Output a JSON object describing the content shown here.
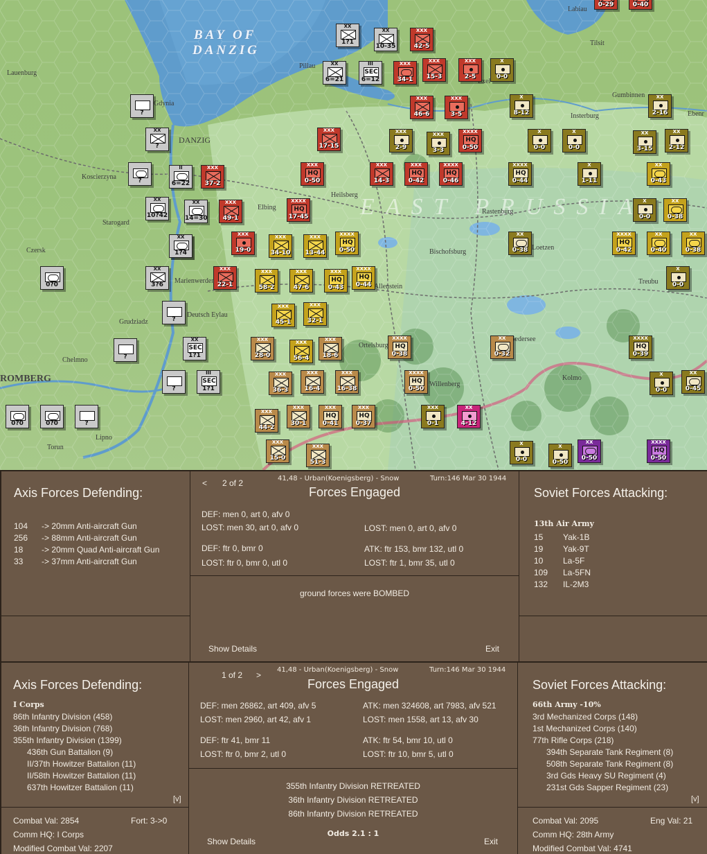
{
  "map": {
    "bay_label_1": "BAY OF",
    "bay_label_2": "DANZIG",
    "region_label": "EAST PRUSSIA",
    "places": [
      {
        "name": "Lauenburg"
      },
      {
        "name": "Gdynia"
      },
      {
        "name": "DANZIG"
      },
      {
        "name": "Koscierzyna"
      },
      {
        "name": "Starogard"
      },
      {
        "name": "Czersk"
      },
      {
        "name": "Elbing"
      },
      {
        "name": "Heilsberg"
      },
      {
        "name": "Marienwerder"
      },
      {
        "name": "Grudziadz"
      },
      {
        "name": "Deutsch Eylau"
      },
      {
        "name": "Chelmno"
      },
      {
        "name": "ROMBERG"
      },
      {
        "name": "Torun"
      },
      {
        "name": "Lipno"
      },
      {
        "name": "Allenstein"
      },
      {
        "name": "Ortelsburg"
      },
      {
        "name": "Willenberg"
      },
      {
        "name": "Bischofsburg"
      },
      {
        "name": "Rastenburg"
      },
      {
        "name": "Loetzen"
      },
      {
        "name": "Insterburg"
      },
      {
        "name": "Gumbinnen"
      },
      {
        "name": "Tilsit"
      },
      {
        "name": "Ebenr"
      },
      {
        "name": "Treubu"
      },
      {
        "name": "Kolmo"
      },
      {
        "name": "Pillau"
      },
      {
        "name": "Jab"
      },
      {
        "name": "Sedersee"
      },
      {
        "name": "Exel"
      },
      {
        "name": "Labiau"
      }
    ],
    "units": [
      {
        "id": "u1",
        "val": "1?1",
        "size": "XX",
        "color": "axis",
        "sym": "x"
      },
      {
        "id": "u2",
        "val": "10-35",
        "size": "XX",
        "color": "axis",
        "sym": "x"
      },
      {
        "id": "u3",
        "val": "42-5",
        "size": "XXX",
        "color": "red",
        "sym": "x"
      },
      {
        "id": "u4",
        "val": "6=21",
        "size": "XX",
        "color": "axis",
        "sym": "x"
      },
      {
        "id": "u5",
        "val": "6=12",
        "size": "III",
        "color": "axis",
        "sym": "hq",
        "label": "SEC"
      },
      {
        "id": "u6",
        "val": "34-1",
        "size": "XXX",
        "color": "red",
        "sym": "oval"
      },
      {
        "id": "u7",
        "val": "15-3",
        "size": "XXX",
        "color": "red",
        "sym": "x"
      },
      {
        "id": "u8",
        "val": "2-5",
        "size": "XXX",
        "color": "red",
        "sym": "dot"
      },
      {
        "id": "u9",
        "val": "0-0",
        "size": "X",
        "color": "olive",
        "sym": "dot"
      },
      {
        "id": "u10",
        "val": "?",
        "size": "",
        "color": "axis",
        "sym": "plain"
      },
      {
        "id": "u11",
        "val": "46-6",
        "size": "XXX",
        "color": "red",
        "sym": "x"
      },
      {
        "id": "u12",
        "val": "3-5",
        "size": "XXX",
        "color": "red",
        "sym": "dot"
      },
      {
        "id": "u13",
        "val": "8-12",
        "size": "X",
        "color": "olive",
        "sym": "dot"
      },
      {
        "id": "u14",
        "val": "2-16",
        "size": "XX",
        "color": "olive",
        "sym": "dot"
      },
      {
        "id": "u15",
        "val": "?",
        "size": "XX",
        "color": "axis",
        "sym": "x"
      },
      {
        "id": "u16",
        "val": "17-15",
        "size": "XXX",
        "color": "red",
        "sym": "x"
      },
      {
        "id": "u17",
        "val": "2-9",
        "size": "XXX",
        "color": "olive",
        "sym": "dot"
      },
      {
        "id": "u18",
        "val": "3-3",
        "size": "XXX",
        "color": "olive",
        "sym": "dot"
      },
      {
        "id": "u19",
        "val": "0-50",
        "size": "XXXX",
        "color": "red",
        "sym": "hq",
        "label": "HQ"
      },
      {
        "id": "u20",
        "val": "0-0",
        "size": "X",
        "color": "olive",
        "sym": "dot"
      },
      {
        "id": "u21",
        "val": "0-0",
        "size": "X",
        "color": "olive",
        "sym": "dot"
      },
      {
        "id": "u22",
        "val": "3-15",
        "size": "XX",
        "color": "olive",
        "sym": "dot"
      },
      {
        "id": "u23",
        "val": "2-12",
        "size": "XX",
        "color": "olive",
        "sym": "dot"
      },
      {
        "id": "u24",
        "val": "?",
        "size": "",
        "color": "axis",
        "sym": "oval"
      },
      {
        "id": "u25",
        "val": "6=22",
        "size": "II",
        "color": "axis",
        "sym": "oval"
      },
      {
        "id": "u26",
        "val": "37-2",
        "size": "XXX",
        "color": "red",
        "sym": "x"
      },
      {
        "id": "u27",
        "val": "0-50",
        "size": "XXX",
        "color": "red",
        "sym": "hq",
        "label": "HQ"
      },
      {
        "id": "u28",
        "val": "14-3",
        "size": "XXX",
        "color": "red",
        "sym": "x"
      },
      {
        "id": "u29",
        "val": "0-42",
        "size": "XXX",
        "color": "red",
        "sym": "hq",
        "label": "HQ"
      },
      {
        "id": "u30",
        "val": "0-46",
        "size": "XXXX",
        "color": "red",
        "sym": "hq",
        "label": "HQ"
      },
      {
        "id": "u31",
        "val": "0-44",
        "size": "XXXX",
        "color": "olive",
        "sym": "hq",
        "label": "HQ"
      },
      {
        "id": "u32",
        "val": "1-11",
        "size": "X",
        "color": "olive",
        "sym": "dot"
      },
      {
        "id": "u33",
        "val": "0-43",
        "size": "XX",
        "color": "yellow",
        "sym": "oval"
      },
      {
        "id": "u34",
        "val": "10?42",
        "size": "XX",
        "color": "axis",
        "sym": "oval"
      },
      {
        "id": "u35",
        "val": "14=30",
        "size": "XX",
        "color": "axis",
        "sym": "oval"
      },
      {
        "id": "u36",
        "val": "49-1",
        "size": "XXX",
        "color": "red",
        "sym": "x"
      },
      {
        "id": "u37",
        "val": "17-45",
        "size": "XXXX",
        "color": "red",
        "sym": "hq",
        "label": "HQ"
      },
      {
        "id": "u38",
        "val": "0-0",
        "size": "X",
        "color": "olive",
        "sym": "dot"
      },
      {
        "id": "u39",
        "val": "0-38",
        "size": "XX",
        "color": "yellow",
        "sym": "oval"
      },
      {
        "id": "u40",
        "val": "?",
        "size": "",
        "color": "axis",
        "sym": "oval"
      },
      {
        "id": "u41",
        "val": "1?4",
        "size": "XX",
        "color": "axis",
        "sym": "oval"
      },
      {
        "id": "u42",
        "val": "19-0",
        "size": "XXX",
        "color": "red",
        "sym": "dot"
      },
      {
        "id": "u43",
        "val": "34-10",
        "size": "XXX",
        "color": "yellow",
        "sym": "x"
      },
      {
        "id": "u44",
        "val": "13-44",
        "size": "XXX",
        "color": "yellow",
        "sym": "x"
      },
      {
        "id": "u45",
        "val": "0-50",
        "size": "XXXX",
        "color": "yellow",
        "sym": "hq",
        "label": "HQ"
      },
      {
        "id": "u46",
        "val": "0-38",
        "size": "XX",
        "color": "olive",
        "sym": "oval"
      },
      {
        "id": "u47",
        "val": "0-42",
        "size": "XXXX",
        "color": "yellow",
        "sym": "hq",
        "label": "HQ"
      },
      {
        "id": "u48",
        "val": "0-40",
        "size": "XX",
        "color": "yellow",
        "sym": "oval"
      },
      {
        "id": "u49",
        "val": "0-38",
        "size": "XX",
        "color": "yellow",
        "sym": "oval"
      },
      {
        "id": "u50",
        "val": "0?0",
        "size": "",
        "color": "axis",
        "sym": "oval"
      },
      {
        "id": "u51",
        "val": "3?6",
        "size": "XX",
        "color": "axis",
        "sym": "x"
      },
      {
        "id": "u52",
        "val": "22-1",
        "size": "XXX",
        "color": "red",
        "sym": "x"
      },
      {
        "id": "u53",
        "val": "58-2",
        "size": "XXX",
        "color": "yellow",
        "sym": "x"
      },
      {
        "id": "u54",
        "val": "47-6",
        "size": "XXX",
        "color": "yellow",
        "sym": "x"
      },
      {
        "id": "u55",
        "val": "0-43",
        "size": "XXX",
        "color": "yellow",
        "sym": "hq",
        "label": "HQ"
      },
      {
        "id": "u56",
        "val": "0-44",
        "size": "XXXX",
        "color": "yellow",
        "sym": "hq",
        "label": "HQ"
      },
      {
        "id": "u57",
        "val": "0-0",
        "size": "X",
        "color": "olive",
        "sym": "dot"
      },
      {
        "id": "u58",
        "val": "?",
        "size": "",
        "color": "axis",
        "sym": "plain"
      },
      {
        "id": "u59",
        "val": "45-1",
        "size": "XXX",
        "color": "yellow",
        "sym": "x"
      },
      {
        "id": "u60",
        "val": "32-1",
        "size": "XXX",
        "color": "yellow",
        "sym": "x"
      },
      {
        "id": "u61",
        "val": "?",
        "size": "",
        "color": "axis",
        "sym": "plain"
      },
      {
        "id": "u62",
        "val": "1?1",
        "size": "XX",
        "color": "axis",
        "sym": "hq",
        "label": "SEC"
      },
      {
        "id": "u63",
        "val": "28-0",
        "size": "XXX",
        "color": "tan",
        "sym": "x"
      },
      {
        "id": "u64",
        "val": "56-4",
        "size": "XXX",
        "color": "yellow",
        "sym": "x"
      },
      {
        "id": "u65",
        "val": "18-6",
        "size": "XXX",
        "color": "tan",
        "sym": "x"
      },
      {
        "id": "u66",
        "val": "0-38",
        "size": "XXXX",
        "color": "tan",
        "sym": "hq",
        "label": "HQ"
      },
      {
        "id": "u67",
        "val": "0-32",
        "size": "XX",
        "color": "tan",
        "sym": "oval"
      },
      {
        "id": "u68",
        "val": "0-39",
        "size": "XXXX",
        "color": "olive",
        "sym": "hq",
        "label": "HQ"
      },
      {
        "id": "u69",
        "val": "?",
        "size": "",
        "color": "axis",
        "sym": "plain"
      },
      {
        "id": "u70",
        "val": "1?1",
        "size": "III",
        "color": "axis",
        "sym": "hq",
        "label": "SEC"
      },
      {
        "id": "u71",
        "val": "36-3",
        "size": "XXX",
        "color": "tan",
        "sym": "x"
      },
      {
        "id": "u72",
        "val": "16-4",
        "size": "XXX",
        "color": "tan",
        "sym": "x"
      },
      {
        "id": "u73",
        "val": "16-38",
        "size": "XXX",
        "color": "tan",
        "sym": "x"
      },
      {
        "id": "u74",
        "val": "0-50",
        "size": "XXXX",
        "color": "tan",
        "sym": "hq",
        "label": "HQ"
      },
      {
        "id": "u75",
        "val": "0-0",
        "size": "X",
        "color": "olive",
        "sym": "dot"
      },
      {
        "id": "u76",
        "val": "0-45",
        "size": "XX",
        "color": "olive",
        "sym": "oval"
      },
      {
        "id": "u77",
        "val": "0?0",
        "size": "",
        "color": "axis",
        "sym": "oval"
      },
      {
        "id": "u78",
        "val": "0?0",
        "size": "",
        "color": "axis",
        "sym": "oval"
      },
      {
        "id": "u79",
        "val": "?",
        "size": "",
        "color": "axis",
        "sym": "plain"
      },
      {
        "id": "u80",
        "val": "44-2",
        "size": "XXX",
        "color": "tan",
        "sym": "x"
      },
      {
        "id": "u81",
        "val": "30-1",
        "size": "XXX",
        "color": "tan",
        "sym": "x"
      },
      {
        "id": "u82",
        "val": "0-41",
        "size": "XXX",
        "color": "tan",
        "sym": "hq",
        "label": "HQ"
      },
      {
        "id": "u83",
        "val": "0-37",
        "size": "XXX",
        "color": "tan",
        "sym": "hq",
        "label": "HQ"
      },
      {
        "id": "u84",
        "val": "0-1",
        "size": "XXX",
        "color": "olive",
        "sym": "dot"
      },
      {
        "id": "u85",
        "val": "4-12",
        "size": "XX",
        "color": "pink",
        "sym": "dot"
      },
      {
        "id": "u86",
        "val": "15-0",
        "size": "XXX",
        "color": "tan",
        "sym": "x"
      },
      {
        "id": "u87",
        "val": "51-3",
        "size": "XXX",
        "color": "tan",
        "sym": "x"
      },
      {
        "id": "u88",
        "val": "0-0",
        "size": "X",
        "color": "olive",
        "sym": "dot"
      },
      {
        "id": "u89",
        "val": "0-50",
        "size": "X",
        "color": "olive",
        "sym": "dot"
      },
      {
        "id": "u90",
        "val": "0-50",
        "size": "XX",
        "color": "purple",
        "sym": "oval"
      },
      {
        "id": "u91",
        "val": "0-50",
        "size": "XXXX",
        "color": "purple",
        "sym": "hq",
        "label": "HQ"
      },
      {
        "id": "u92",
        "val": "0-29",
        "size": "",
        "color": "red",
        "sym": "x"
      },
      {
        "id": "u93",
        "val": "0-40",
        "size": "",
        "color": "red",
        "sym": "x"
      }
    ]
  },
  "top": {
    "left": {
      "title": "Axis Forces Defending:",
      "items": [
        {
          "n": "104",
          "t": "-> 20mm Anti-aircraft Gun"
        },
        {
          "n": "256",
          "t": "-> 88mm Anti-aircraft Gun"
        },
        {
          "n": "18",
          "t": "-> 20mm Quad Anti-aircraft Gun"
        },
        {
          "n": "33",
          "t": "-> 37mm Anti-aircraft Gun"
        }
      ]
    },
    "center": {
      "prev": "<",
      "page": "2 of 2",
      "location": "41,48 - Urban(Koenigsberg) - Snow",
      "turn": "Turn:146  Mar 30 1944",
      "title": "Forces Engaged",
      "def1": "DEF: men 0, art 0, afv 0",
      "lost1": "LOST: men 30, art 0, afv 0",
      "lost1r": "LOST: men 0, art 0, afv 0",
      "def2": "DEF: ftr 0, bmr 0",
      "lost2": "LOST: ftr 0, bmr 0, utl 0",
      "atk2": "ATK: ftr 153, bmr 132, utl 0",
      "lost2r": "LOST: ftr 1, bmr 35, utl 0",
      "result": "ground forces were BOMBED",
      "show_details": "Show Details",
      "exit": "Exit"
    },
    "right": {
      "title": "Soviet Forces Attacking:",
      "army": "13th Air Army",
      "items": [
        {
          "n": "15",
          "t": "Yak-1B"
        },
        {
          "n": "19",
          "t": "Yak-9T"
        },
        {
          "n": "10",
          "t": "La-5F"
        },
        {
          "n": "109",
          "t": "La-5FN"
        },
        {
          "n": "132",
          "t": "IL-2M3"
        }
      ]
    }
  },
  "bottom": {
    "left": {
      "title": "Axis Forces Defending:",
      "corps": "I Corps",
      "items": [
        "86th Infantry Division (458)",
        "36th Infantry Division (768)",
        "355th Infantry Division (1399)"
      ],
      "subitems": [
        "436th Gun Battalion (9)",
        "II/37th Howitzer Battalion (11)",
        "II/58th Howitzer Battalion (11)",
        "637th Howitzer Battalion (11)"
      ],
      "expand": "[v]",
      "combat_val": "Combat Val: 2854",
      "fort": "Fort: 3->0",
      "comm_hq": "Comm HQ: I Corps",
      "mod_combat": "Modified Combat Val: 2207"
    },
    "center": {
      "page": "1 of 2",
      "next": ">",
      "location": "41,48 - Urban(Koenigsberg) - Snow",
      "turn": "Turn:146  Mar 30 1944",
      "title": "Forces Engaged",
      "def1": "DEF: men 26862, art 409, afv 5",
      "atk1": "ATK: men 324608, art 7983, afv 521",
      "lost1": "LOST: men 2960, art 42, afv 1",
      "lost1r": "LOST: men 1558, art 13, afv 30",
      "def2": "DEF: ftr 41, bmr 11",
      "atk2": "ATK: ftr 54, bmr 10, utl 0",
      "lost2": "LOST: ftr 0, bmr 2, utl 0",
      "lost2r": "LOST: ftr 10, bmr 5, utl 0",
      "results": [
        "355th Infantry Division RETREATED",
        "36th Infantry Division RETREATED",
        "86th Infantry Division RETREATED"
      ],
      "odds": "Odds 2.1 : 1",
      "show_details": "Show Details",
      "exit": "Exit"
    },
    "right": {
      "title": "Soviet Forces Attacking:",
      "army": "66th Army  -10%",
      "items": [
        "3rd Mechanized Corps (148)",
        "1st Mechanized Corps (140)",
        "77th Rifle Corps (218)"
      ],
      "subitems": [
        "394th Separate Tank Regiment (8)",
        "508th Separate Tank Regiment (8)",
        "3rd Gds Heavy SU Regiment (4)",
        "231st Gds Sapper Regiment (23)"
      ],
      "expand": "[v]",
      "combat_val": "Combat Val: 2095",
      "eng_val": "Eng Val: 21",
      "comm_hq": "Comm HQ: 28th Army",
      "mod_combat": "Modified Combat Val: 4741"
    }
  }
}
